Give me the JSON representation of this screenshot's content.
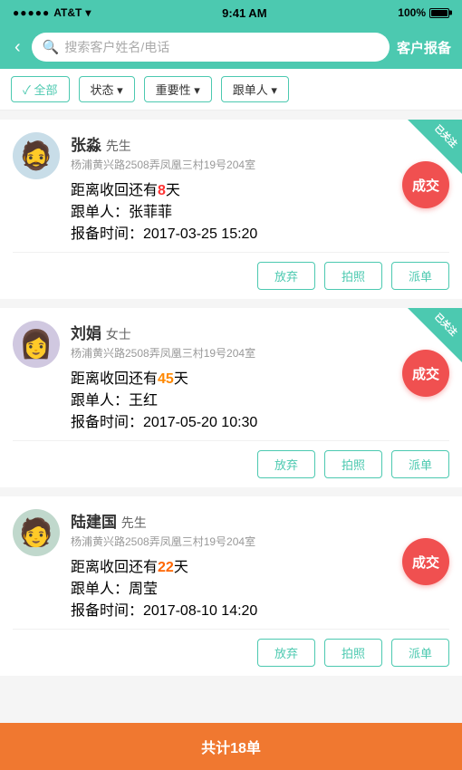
{
  "statusBar": {
    "carrier": "AT&T",
    "wifi": "wifi",
    "time": "9:41 AM",
    "battery": "100%"
  },
  "searchBar": {
    "back": "‹",
    "placeholder": "搜索客户姓名/电话",
    "title": "客户报备"
  },
  "filters": {
    "all": "✓ 全部",
    "status": "状态 ▾",
    "importance": "重要性 ▾",
    "follower": "跟单人 ▾"
  },
  "cards": [
    {
      "id": "card-1",
      "badge": "已关注",
      "name": "张淼",
      "title": "先生",
      "address": "杨浦黄兴路2508弄凤凰三村19号204室",
      "daysLabel": "距离收回还有",
      "days": "8",
      "daysUnit": "天",
      "followerLabel": "跟单人：张菲菲",
      "timeLabel": "报备时间：2017-03-25 15:20",
      "dealBtn": "成交",
      "actions": [
        "放弃",
        "拍照",
        "派单"
      ],
      "avatarType": "man",
      "avatarEmoji": "🧔"
    },
    {
      "id": "card-2",
      "badge": "已关注",
      "name": "刘娟",
      "title": "女士",
      "address": "杨浦黄兴路2508弄凤凰三村19号204室",
      "daysLabel": "距离收回还有",
      "days": "45",
      "daysUnit": "天",
      "followerLabel": "跟单人：王红",
      "timeLabel": "报备时间：2017-05-20 10:30",
      "dealBtn": "成交",
      "actions": [
        "放弃",
        "拍照",
        "派单"
      ],
      "avatarType": "woman",
      "avatarEmoji": "👩"
    },
    {
      "id": "card-3",
      "badge": null,
      "name": "陆建国",
      "title": "先生",
      "address": "杨浦黄兴路2508弄凤凰三村19号204室",
      "daysLabel": "距离收回还有",
      "days": "22",
      "daysUnit": "天",
      "followerLabel": "跟单人：周莹",
      "timeLabel": "报备时间：2017-08-10 14:20",
      "dealBtn": "成交",
      "actions": [
        "放弃",
        "拍照",
        "派单"
      ],
      "avatarType": "man2",
      "avatarEmoji": "👨"
    }
  ],
  "bottomBar": {
    "label": "共计18单"
  }
}
